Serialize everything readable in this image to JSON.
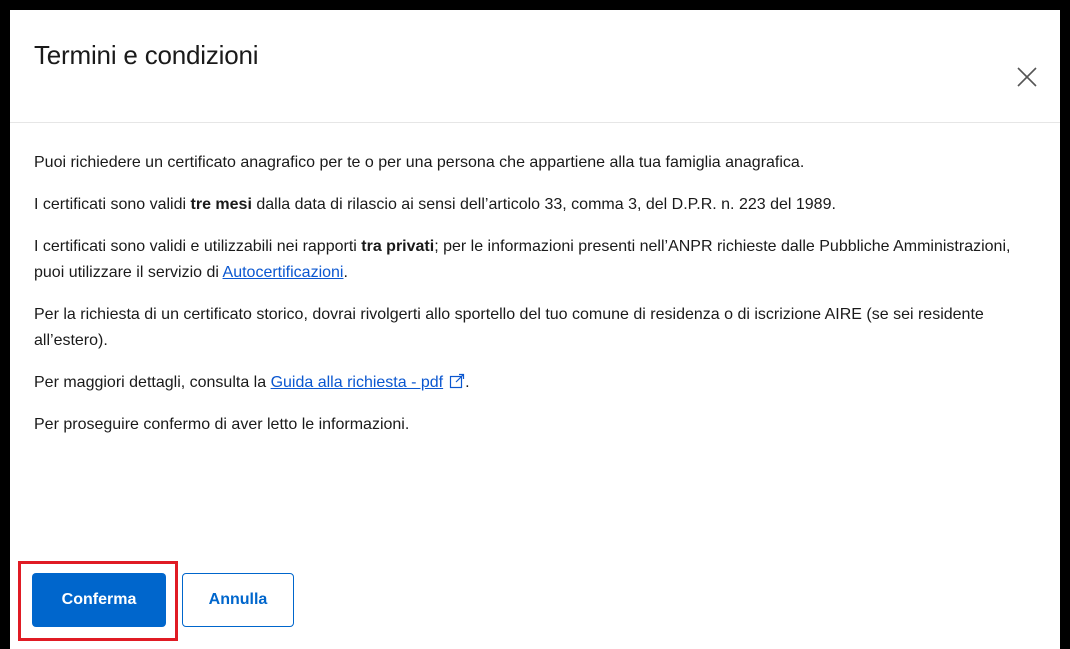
{
  "modal": {
    "title": "Termini e condizioni",
    "close_icon": "close-icon",
    "paragraphs": {
      "p1": "Puoi richiedere un certificato anagrafico per te o per una persona che appartiene alla tua famiglia anagrafica.",
      "p2_pre": "I certificati sono validi ",
      "p2_bold": "tre mesi",
      "p2_post": " dalla data di rilascio ai sensi dell’articolo 33, comma 3, del D.P.R. n. 223 del 1989.",
      "p3_pre": "I certificati sono validi e utilizzabili nei rapporti ",
      "p3_bold": "tra privati",
      "p3_mid": "; per le informazioni presenti nell’ANPR richieste dalle Pubbliche Amministrazioni, puoi utilizzare il servizio di ",
      "p3_link": "Autocertificazioni",
      "p3_post": ".",
      "p4": "Per la richiesta di un certificato storico, dovrai rivolgerti allo sportello del tuo comune di residenza o di iscrizione AIRE (se sei residente all’estero).",
      "p5_pre": "Per maggiori dettagli, consulta la ",
      "p5_link": "Guida alla richiesta - pdf",
      "p5_icon": "external-link-icon",
      "p5_post": ".",
      "p6": "Per proseguire confermo di aver letto le informazioni."
    },
    "buttons": {
      "confirm": "Conferma",
      "cancel": "Annulla"
    },
    "colors": {
      "primary": "#0066cc",
      "link": "#0b57d0",
      "highlight": "#e01b24"
    }
  }
}
